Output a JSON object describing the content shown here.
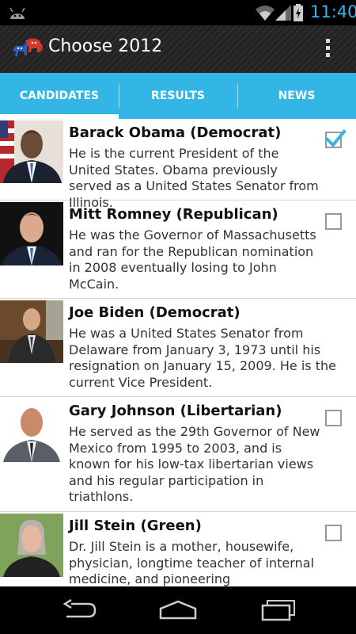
{
  "status_bar": {
    "time": "11:40",
    "icons": [
      "android-icon",
      "wifi-icon",
      "signal-icon",
      "battery-icon"
    ],
    "clock_color": "#33b5e5"
  },
  "action_bar": {
    "title": "Choose 2012",
    "logo_icon": "democrat-republican-logo-icon",
    "overflow_icon": "overflow-menu-icon"
  },
  "tabs": [
    {
      "label": "CANDIDATES",
      "active": true
    },
    {
      "label": "RESULTS",
      "active": false
    },
    {
      "label": "NEWS",
      "active": false
    }
  ],
  "accent_color": "#33b5e5",
  "candidates": [
    {
      "name": "Barack Obama (Democrat)",
      "description": "He is the current President of the United States. Obama previously served as a United States Senator from Illinois.",
      "checked": true
    },
    {
      "name": "Mitt Romney (Republican)",
      "description": "He was the Governor of Massachusetts and ran for the Republican nomination in 2008 eventually losing to John McCain.",
      "checked": false
    },
    {
      "name": "Joe Biden (Democrat)",
      "description": "He was a United States Senator from Delaware from January 3, 1973 until his resignation on January 15, 2009. He is the current Vice President.",
      "checked": false
    },
    {
      "name": "Gary Johnson (Libertarian)",
      "description": "He served as the 29th Governor of New Mexico from 1995 to 2003, and is known for his low-tax libertarian views and his regular participation in triathlons.",
      "checked": false
    },
    {
      "name": "Jill Stein (Green)",
      "description": "Dr. Jill Stein is a mother, housewife, physician, longtime teacher of internal medicine, and pioneering",
      "checked": false
    }
  ],
  "nav_bar": {
    "icons": [
      "back-icon",
      "home-icon",
      "recent-apps-icon"
    ]
  }
}
